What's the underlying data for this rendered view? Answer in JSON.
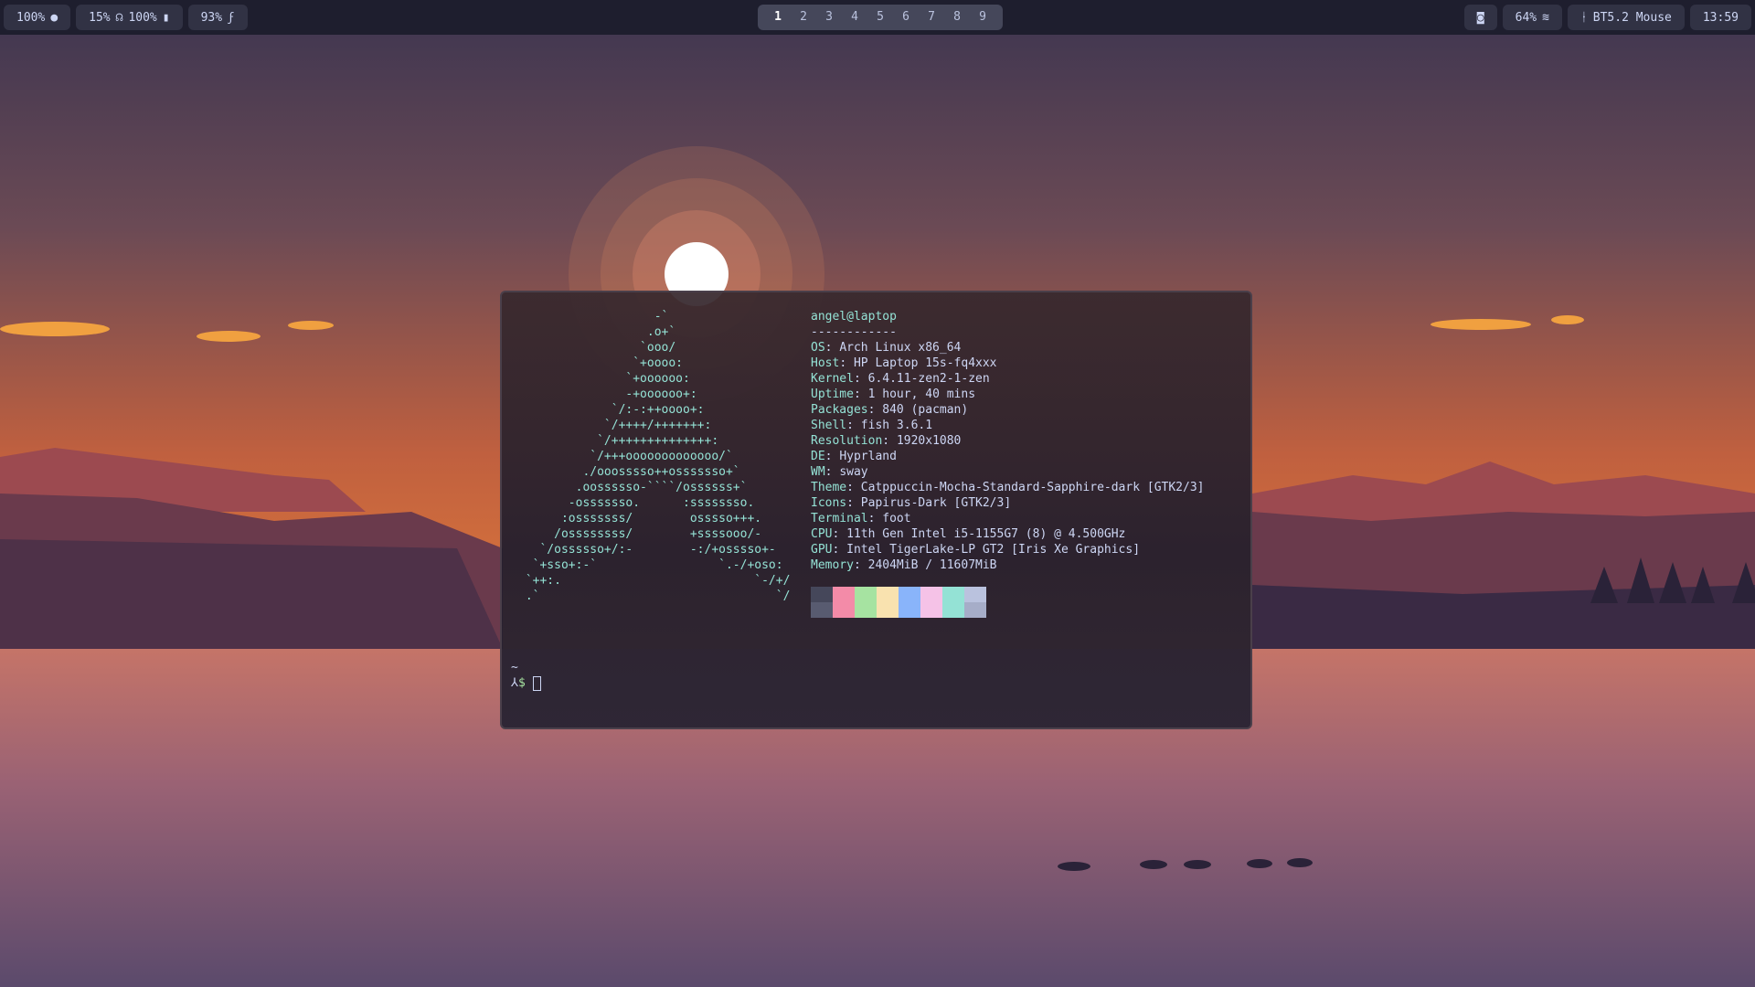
{
  "topbar": {
    "left": [
      {
        "text": "100%",
        "icon": "brightness-dot-icon"
      },
      {
        "text": "15%",
        "icon2": "headphones-icon",
        "text2": "100%",
        "icon3": "microphone-icon"
      },
      {
        "text": "93%",
        "icon": "charging-bolt-icon"
      }
    ],
    "workspaces": [
      "1",
      "2",
      "3",
      "4",
      "5",
      "6",
      "7",
      "8",
      "9"
    ],
    "active_workspace": "1",
    "right": {
      "discord_icon": "discord-icon",
      "wifi": "64%",
      "bluetooth": "BT5.2 Mouse",
      "clock": "13:59"
    }
  },
  "terminal": {
    "logo": [
      "                   -`",
      "                  .o+`",
      "                 `ooo/",
      "                `+oooo:",
      "               `+oooooo:",
      "               -+oooooo+:",
      "             `/:-:++oooo+:",
      "            `/++++/+++++++:",
      "           `/++++++++++++++:",
      "          `/+++ooooooooooooo/`",
      "         ./ooosssso++osssssso+`",
      "        .oossssso-````/ossssss+`",
      "       -osssssso.      :ssssssso.",
      "      :osssssss/        osssso+++.",
      "     /ossssssss/        +ssssooo/-",
      "   `/ossssso+/:-        -:/+osssso+-",
      "  `+sso+:-`                 `.-/+oso:",
      " `++:.                           `-/+/",
      " .`                                 `/"
    ],
    "title": "angel@laptop",
    "separator": "------------",
    "info": [
      {
        "key": "OS",
        "value": "Arch Linux x86_64"
      },
      {
        "key": "Host",
        "value": "HP Laptop 15s-fq4xxx"
      },
      {
        "key": "Kernel",
        "value": "6.4.11-zen2-1-zen"
      },
      {
        "key": "Uptime",
        "value": "1 hour, 40 mins"
      },
      {
        "key": "Packages",
        "value": "840 (pacman)"
      },
      {
        "key": "Shell",
        "value": "fish 3.6.1"
      },
      {
        "key": "Resolution",
        "value": "1920x1080"
      },
      {
        "key": "DE",
        "value": "Hyprland"
      },
      {
        "key": "WM",
        "value": "sway"
      },
      {
        "key": "Theme",
        "value": "Catppuccin-Mocha-Standard-Sapphire-dark [GTK2/3]"
      },
      {
        "key": "Icons",
        "value": "Papirus-Dark [GTK2/3]"
      },
      {
        "key": "Terminal",
        "value": "foot"
      },
      {
        "key": "CPU",
        "value": "11th Gen Intel i5-1155G7 (8) @ 4.500GHz"
      },
      {
        "key": "GPU",
        "value": "Intel TigerLake-LP GT2 [Iris Xe Graphics]"
      },
      {
        "key": "Memory",
        "value": "2404MiB / 11607MiB"
      }
    ],
    "palette_top": [
      "#45475a",
      "#f38ba8",
      "#a6e3a1",
      "#f9e2af",
      "#89b4fa",
      "#f5c2e7",
      "#94e2d5",
      "#bac2de"
    ],
    "palette_bottom": [
      "#585b70",
      "#f38ba8",
      "#a6e3a1",
      "#f9e2af",
      "#89b4fa",
      "#f5c2e7",
      "#94e2d5",
      "#a6adc8"
    ],
    "cwd": "~",
    "prompt_symbol": "⅄",
    "prompt_dollar": "$"
  }
}
